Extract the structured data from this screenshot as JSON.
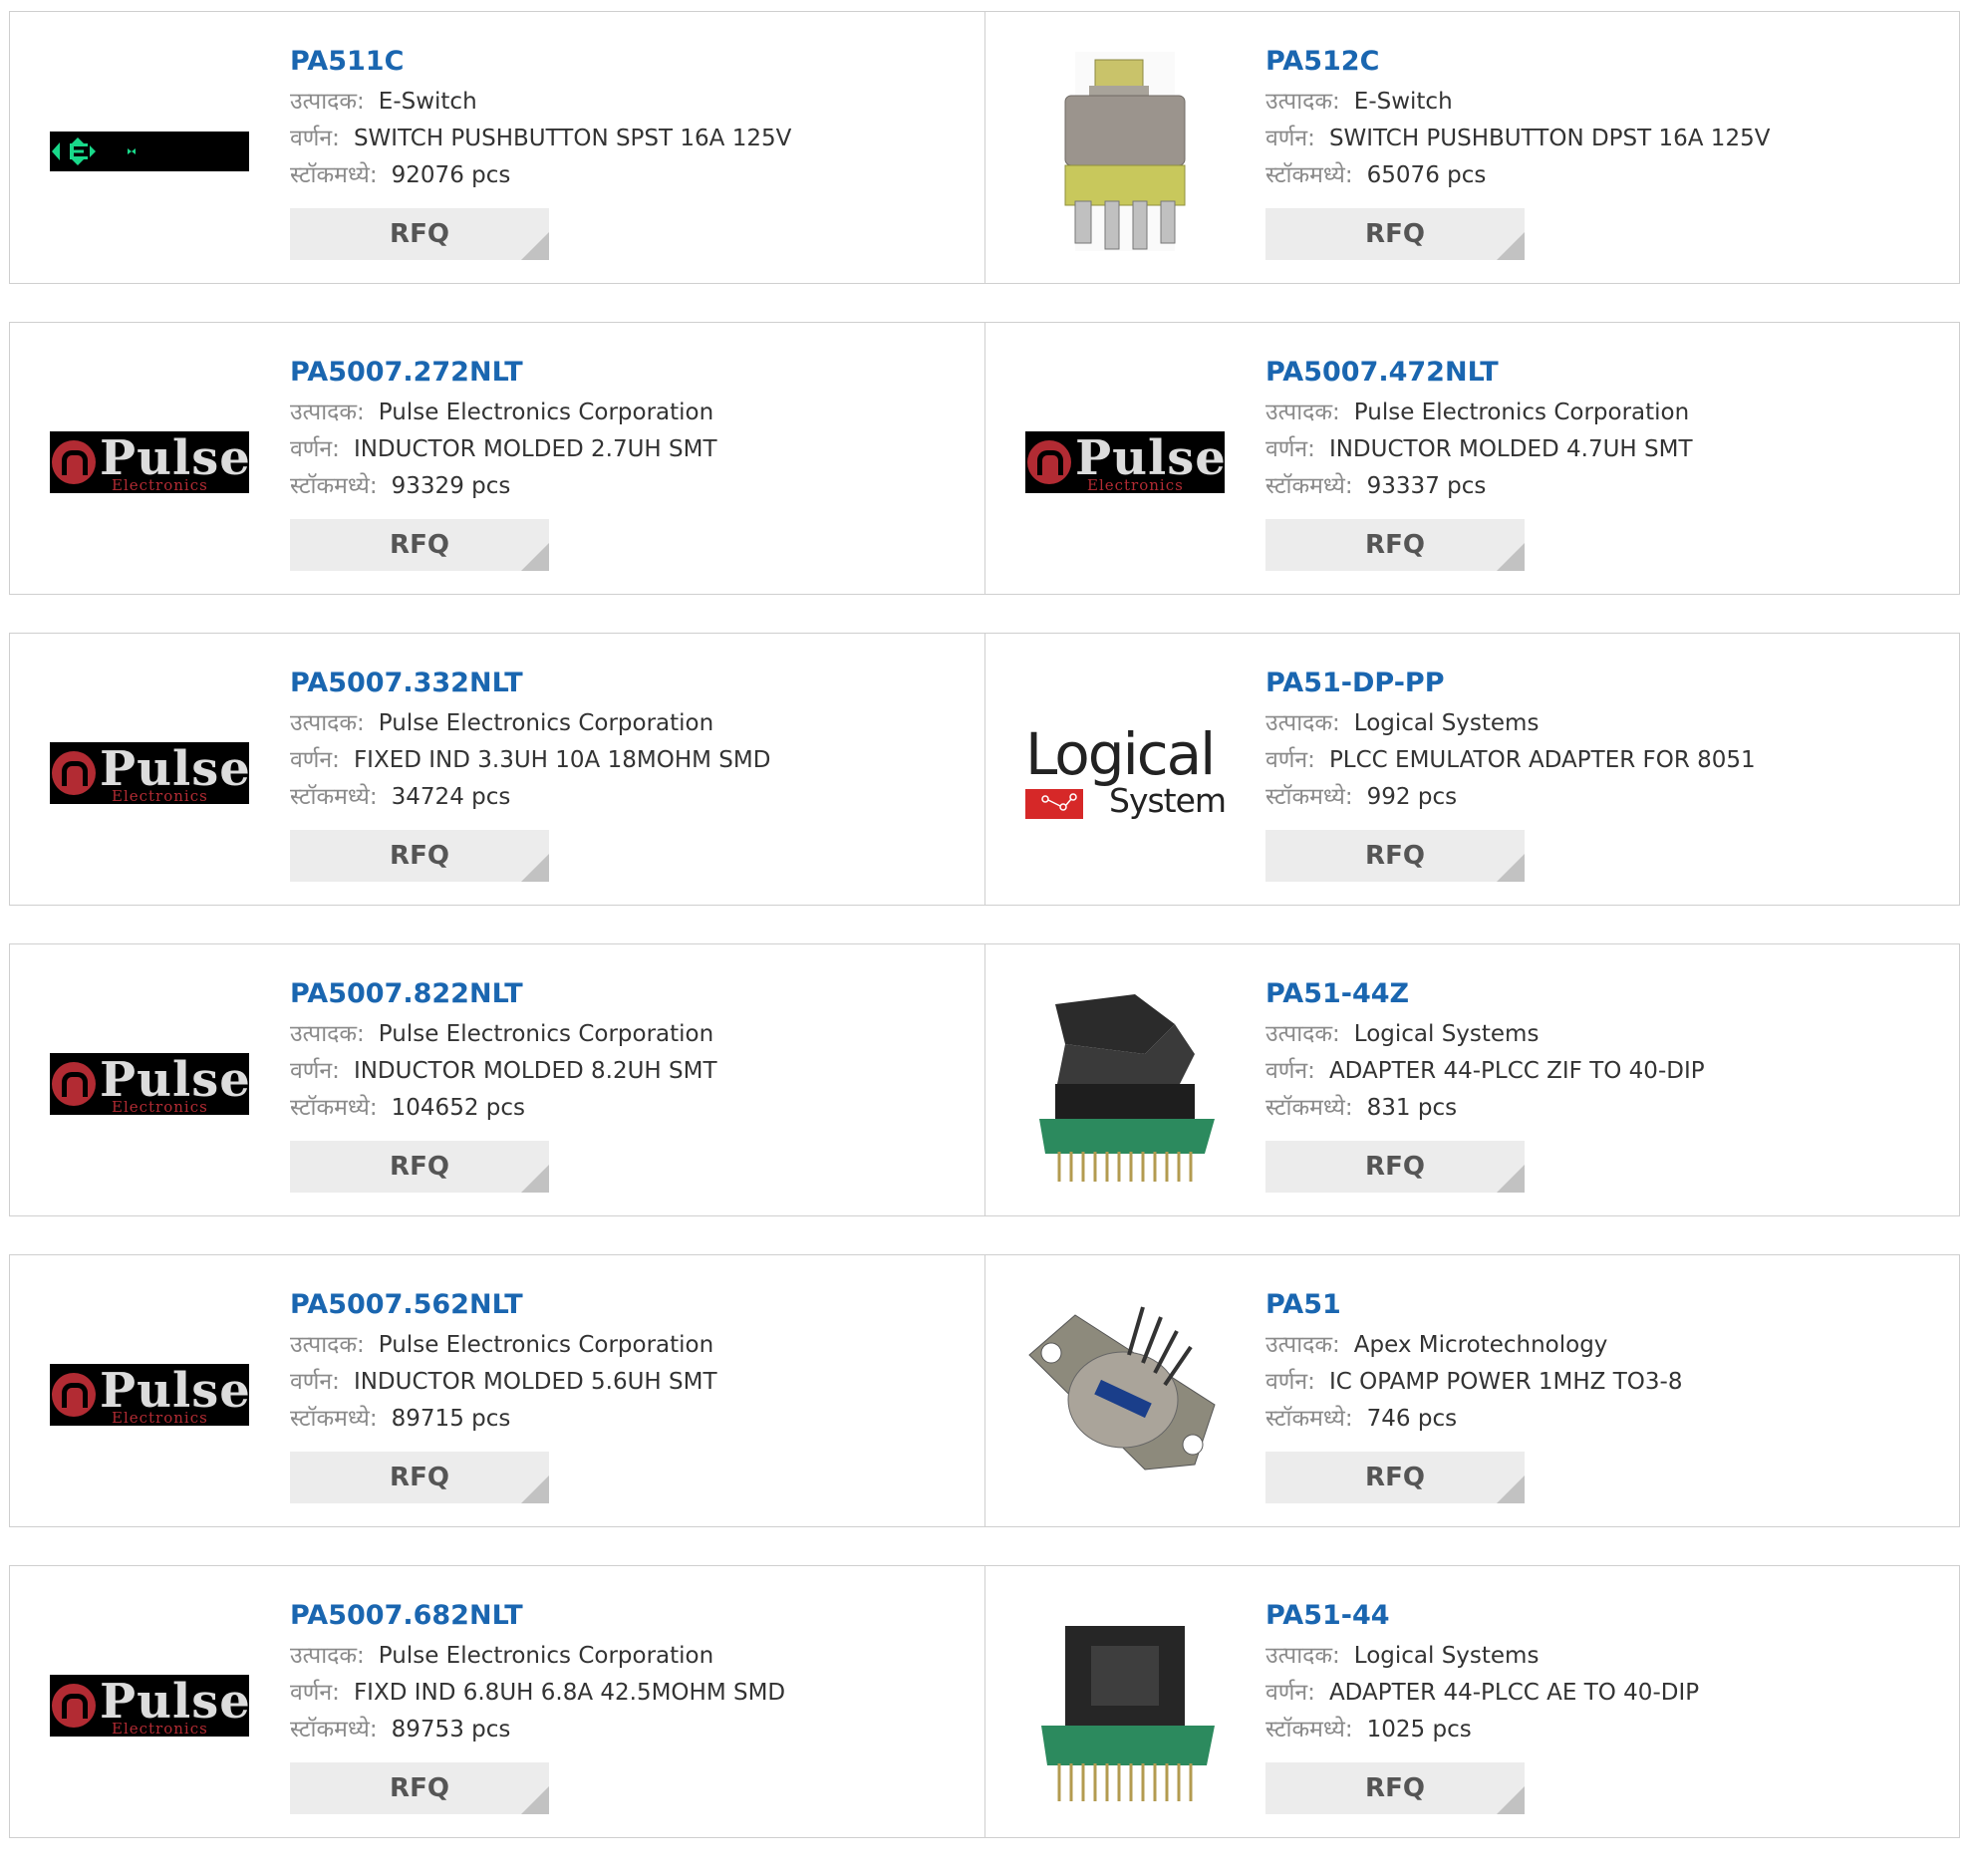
{
  "labels": {
    "manufacturer": "उत्पादक:",
    "description": "वर्णन:",
    "stock": "स्टॉकमध्ये:",
    "rfq": "RFQ"
  },
  "logo_text": {
    "pulse": "Pulse",
    "pulse_sub": "Electronics",
    "logical": "Logical",
    "logical_sub": "Systems"
  },
  "colors": {
    "part_link": "#1a66b0",
    "label": "#8a8a8a",
    "rfq_bg": "#ececec"
  },
  "products": [
    {
      "part": "PA511C",
      "manufacturer": "E-Switch",
      "description": "SWITCH PUSHBUTTON SPST 16A 125V",
      "stock": "92076 pcs",
      "image": "eswitch-logo"
    },
    {
      "part": "PA512C",
      "manufacturer": "E-Switch",
      "description": "SWITCH PUSHBUTTON DPST 16A 125V",
      "stock": "65076 pcs",
      "image": "pushbutton-photo"
    },
    {
      "part": "PA5007.272NLT",
      "manufacturer": "Pulse Electronics Corporation",
      "description": "INDUCTOR MOLDED 2.7UH SMT",
      "stock": "93329 pcs",
      "image": "pulse-logo"
    },
    {
      "part": "PA5007.472NLT",
      "manufacturer": "Pulse Electronics Corporation",
      "description": "INDUCTOR MOLDED 4.7UH SMT",
      "stock": "93337 pcs",
      "image": "pulse-logo"
    },
    {
      "part": "PA5007.332NLT",
      "manufacturer": "Pulse Electronics Corporation",
      "description": "FIXED IND 3.3UH 10A 18MOHM SMD",
      "stock": "34724 pcs",
      "image": "pulse-logo"
    },
    {
      "part": "PA51-DP-PP",
      "manufacturer": "Logical Systems",
      "description": "PLCC EMULATOR ADAPTER FOR 8051",
      "stock": "992 pcs",
      "image": "logical-systems-logo"
    },
    {
      "part": "PA5007.822NLT",
      "manufacturer": "Pulse Electronics Corporation",
      "description": "INDUCTOR MOLDED 8.2UH SMT",
      "stock": "104652 pcs",
      "image": "pulse-logo"
    },
    {
      "part": "PA51-44Z",
      "manufacturer": "Logical Systems",
      "description": "ADAPTER 44-PLCC ZIF TO 40-DIP",
      "stock": "831 pcs",
      "image": "zif-adapter-photo"
    },
    {
      "part": "PA5007.562NLT",
      "manufacturer": "Pulse Electronics Corporation",
      "description": "INDUCTOR MOLDED 5.6UH SMT",
      "stock": "89715 pcs",
      "image": "pulse-logo"
    },
    {
      "part": "PA51",
      "manufacturer": "Apex Microtechnology",
      "description": "IC OPAMP POWER 1MHZ TO3-8",
      "stock": "746 pcs",
      "image": "to3-package-photo"
    },
    {
      "part": "PA5007.682NLT",
      "manufacturer": "Pulse Electronics Corporation",
      "description": "FIXD IND 6.8UH 6.8A 42.5MOHM SMD",
      "stock": "89753 pcs",
      "image": "pulse-logo"
    },
    {
      "part": "PA51-44",
      "manufacturer": "Logical Systems",
      "description": "ADAPTER 44-PLCC AE TO 40-DIP",
      "stock": "1025 pcs",
      "image": "plcc-adapter-photo"
    }
  ]
}
